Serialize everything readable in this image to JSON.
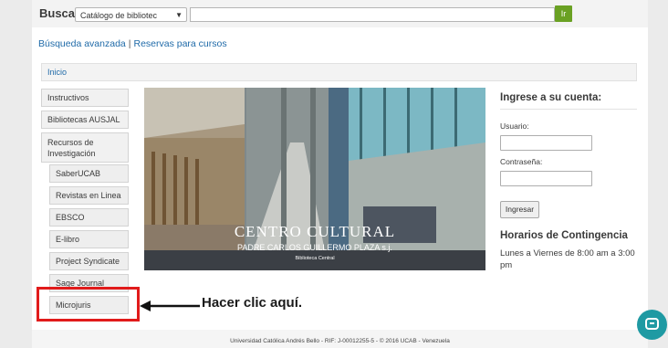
{
  "search": {
    "label": "Buscar",
    "catalog_select": "Catálogo de bibliotec",
    "go_label": "Ir"
  },
  "links": {
    "advanced": "Búsqueda avanzada",
    "separator": "|",
    "reserves": "Reservas para cursos"
  },
  "breadcrumb": {
    "home": "Inicio"
  },
  "sidebar": {
    "items": [
      {
        "label": "Instructivos",
        "sub": false
      },
      {
        "label": "Bibliotecas AUSJAL",
        "sub": false
      },
      {
        "label": "Recursos de Investigación",
        "sub": false
      },
      {
        "label": "SaberUCAB",
        "sub": true
      },
      {
        "label": "Revistas en Linea",
        "sub": true
      },
      {
        "label": "EBSCO",
        "sub": true
      },
      {
        "label": "E-libro",
        "sub": true
      },
      {
        "label": "Project Syndicate",
        "sub": true
      },
      {
        "label": "Sage Journal",
        "sub": true
      },
      {
        "label": "Microjuris",
        "sub": true
      }
    ]
  },
  "hero": {
    "title": "CENTRO CULTURAL",
    "subtitle": "PADRE CARLOS GUILLERMO PLAZA s.j.",
    "caption": "Biblioteca Central"
  },
  "login": {
    "title": "Ingrese a su cuenta:",
    "user_label": "Usuario:",
    "password_label": "Contraseña:",
    "button_label": "Ingresar"
  },
  "hours": {
    "title": "Horarios de Contingencia",
    "text": "Lunes a Viernes de 8:00 am a 3:00 pm"
  },
  "annotation": {
    "text": "Hacer clic aquí."
  },
  "footer": {
    "text": "Universidad Católica Andrés Bello - RIF: J-00012255-5 - © 2016 UCAB - Venezuela"
  },
  "colors": {
    "link": "#1f6aa8",
    "go_button": "#6aa123",
    "highlight": "#e11b1b",
    "chat_button": "#1f9aa3"
  }
}
